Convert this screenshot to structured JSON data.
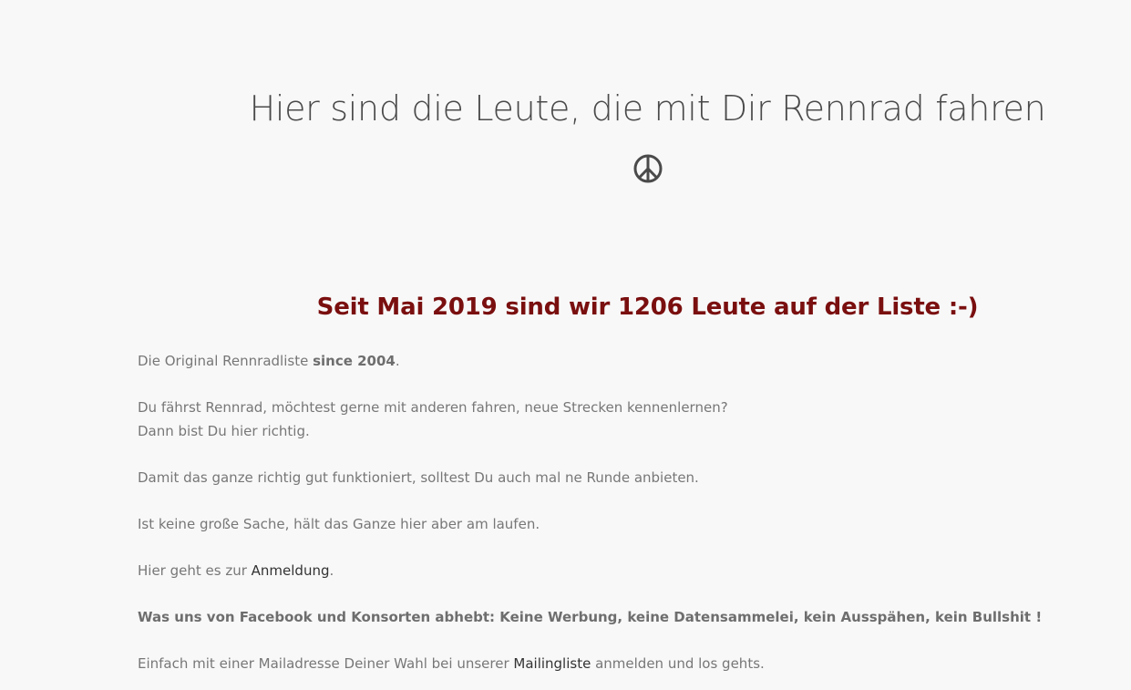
{
  "header": {
    "title": "Hier sind die Leute, die mit Dir Rennrad fahren",
    "icon": "peace-icon"
  },
  "subtitle": "Seit Mai 2019 sind wir 1206 Leute auf der Liste :-)",
  "content": {
    "p1_text": "Die Original Rennradliste ",
    "p1_bold": "since 2004",
    "p1_end": ".",
    "p2_line1": "Du fährst Rennrad, möchtest  gerne mit anderen fahren, neue Strecken kennenlernen?",
    "p2_line2": "Dann bist Du hier richtig.",
    "p3": "Damit das ganze richtig gut funktioniert, solltest Du auch mal ne Runde anbieten.",
    "p4": "Ist keine große Sache, hält das Ganze hier aber am laufen.",
    "p5_text": "Hier geht es zur ",
    "p5_link": "Anmeldung",
    "p5_end": ".",
    "p6_bold": "Was uns von Facebook und Konsorten abhebt: Keine Werbung, keine Datensammelei, kein Ausspähen, kein Bullshit !",
    "p7_text": "Einfach mit einer Mailadresse Deiner Wahl bei unserer ",
    "p7_link": "Mailingliste",
    "p7_end": " anmelden und los gehts."
  },
  "colors": {
    "background": "#f8f8f8",
    "title": "#4a4a4a",
    "subtitle": "#7a0f0f",
    "body_text": "#777777",
    "link": "#333333"
  }
}
